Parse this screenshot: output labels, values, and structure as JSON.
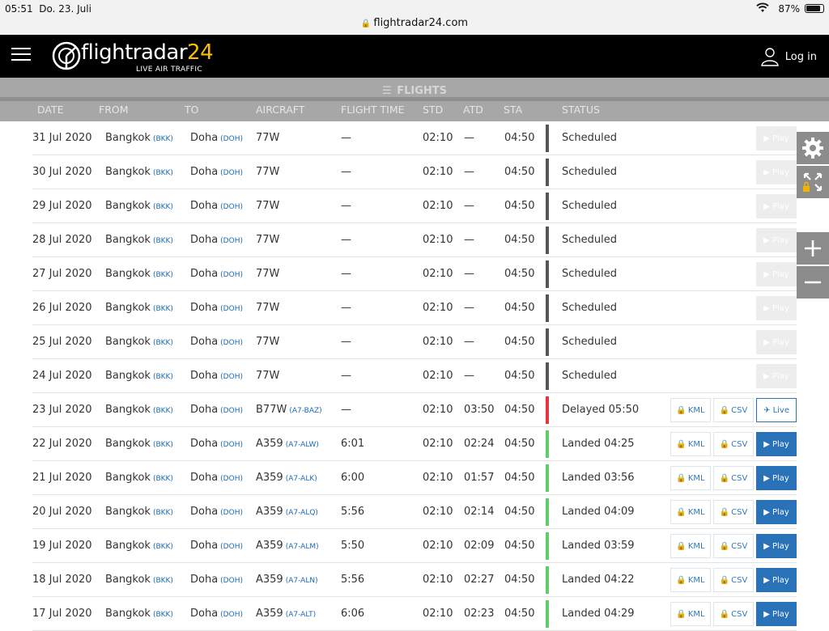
{
  "statusbar": {
    "time": "05:51",
    "date": "Do. 23. Juli",
    "battery": "87%",
    "battery_level": 0.87
  },
  "browser": {
    "url": "flightradar24.com"
  },
  "header": {
    "logo_word": "flightradar",
    "logo_num": "24",
    "logo_sub": "LIVE AIR TRAFFIC",
    "login_label": "Log in"
  },
  "flights_bar": {
    "title": "FLIGHTS",
    "columns": [
      "DATE",
      "FROM",
      "TO",
      "AIRCRAFT",
      "FLIGHT TIME",
      "STD",
      "ATD",
      "STA",
      "STATUS"
    ]
  },
  "colors": {
    "scheduled": "#555555",
    "delayed": "#e8343c",
    "landed": "#5fce6a",
    "accent": "#2a72b8",
    "logo_yellow": "#f5c000"
  },
  "rows": [
    {
      "date": "31 Jul 2020",
      "from": "Bangkok",
      "from_code": "(BKK)",
      "to": "Doha",
      "to_code": "(DOH)",
      "aircraft": "77W",
      "reg": "",
      "flight_time": "—",
      "std": "02:10",
      "atd": "—",
      "sta": "04:50",
      "status": "Scheduled",
      "status_kind": "scheduled",
      "play_label": "Play"
    },
    {
      "date": "30 Jul 2020",
      "from": "Bangkok",
      "from_code": "(BKK)",
      "to": "Doha",
      "to_code": "(DOH)",
      "aircraft": "77W",
      "reg": "",
      "flight_time": "—",
      "std": "02:10",
      "atd": "—",
      "sta": "04:50",
      "status": "Scheduled",
      "status_kind": "scheduled",
      "play_label": "Play"
    },
    {
      "date": "29 Jul 2020",
      "from": "Bangkok",
      "from_code": "(BKK)",
      "to": "Doha",
      "to_code": "(DOH)",
      "aircraft": "77W",
      "reg": "",
      "flight_time": "—",
      "std": "02:10",
      "atd": "—",
      "sta": "04:50",
      "status": "Scheduled",
      "status_kind": "scheduled",
      "play_label": "Play"
    },
    {
      "date": "28 Jul 2020",
      "from": "Bangkok",
      "from_code": "(BKK)",
      "to": "Doha",
      "to_code": "(DOH)",
      "aircraft": "77W",
      "reg": "",
      "flight_time": "—",
      "std": "02:10",
      "atd": "—",
      "sta": "04:50",
      "status": "Scheduled",
      "status_kind": "scheduled",
      "play_label": "Play"
    },
    {
      "date": "27 Jul 2020",
      "from": "Bangkok",
      "from_code": "(BKK)",
      "to": "Doha",
      "to_code": "(DOH)",
      "aircraft": "77W",
      "reg": "",
      "flight_time": "—",
      "std": "02:10",
      "atd": "—",
      "sta": "04:50",
      "status": "Scheduled",
      "status_kind": "scheduled",
      "play_label": "Play"
    },
    {
      "date": "26 Jul 2020",
      "from": "Bangkok",
      "from_code": "(BKK)",
      "to": "Doha",
      "to_code": "(DOH)",
      "aircraft": "77W",
      "reg": "",
      "flight_time": "—",
      "std": "02:10",
      "atd": "—",
      "sta": "04:50",
      "status": "Scheduled",
      "status_kind": "scheduled",
      "play_label": "Play"
    },
    {
      "date": "25 Jul 2020",
      "from": "Bangkok",
      "from_code": "(BKK)",
      "to": "Doha",
      "to_code": "(DOH)",
      "aircraft": "77W",
      "reg": "",
      "flight_time": "—",
      "std": "02:10",
      "atd": "—",
      "sta": "04:50",
      "status": "Scheduled",
      "status_kind": "scheduled",
      "play_label": "Play"
    },
    {
      "date": "24 Jul 2020",
      "from": "Bangkok",
      "from_code": "(BKK)",
      "to": "Doha",
      "to_code": "(DOH)",
      "aircraft": "77W",
      "reg": "",
      "flight_time": "—",
      "std": "02:10",
      "atd": "—",
      "sta": "04:50",
      "status": "Scheduled",
      "status_kind": "scheduled",
      "play_label": "Play"
    },
    {
      "date": "23 Jul 2020",
      "from": "Bangkok",
      "from_code": "(BKK)",
      "to": "Doha",
      "to_code": "(DOH)",
      "aircraft": "B77W",
      "reg": "(A7-BAZ)",
      "flight_time": "—",
      "std": "02:10",
      "atd": "03:50",
      "sta": "04:50",
      "status": "Delayed 05:50",
      "status_kind": "delayed",
      "kml": "KML",
      "csv": "CSV",
      "play_label": "Live"
    },
    {
      "date": "22 Jul 2020",
      "from": "Bangkok",
      "from_code": "(BKK)",
      "to": "Doha",
      "to_code": "(DOH)",
      "aircraft": "A359",
      "reg": "(A7-ALW)",
      "flight_time": "6:01",
      "std": "02:10",
      "atd": "02:24",
      "sta": "04:50",
      "status": "Landed 04:25",
      "status_kind": "landed",
      "kml": "KML",
      "csv": "CSV",
      "play_label": "Play"
    },
    {
      "date": "21 Jul 2020",
      "from": "Bangkok",
      "from_code": "(BKK)",
      "to": "Doha",
      "to_code": "(DOH)",
      "aircraft": "A359",
      "reg": "(A7-ALK)",
      "flight_time": "6:00",
      "std": "02:10",
      "atd": "01:57",
      "sta": "04:50",
      "status": "Landed 03:56",
      "status_kind": "landed",
      "kml": "KML",
      "csv": "CSV",
      "play_label": "Play"
    },
    {
      "date": "20 Jul 2020",
      "from": "Bangkok",
      "from_code": "(BKK)",
      "to": "Doha",
      "to_code": "(DOH)",
      "aircraft": "A359",
      "reg": "(A7-ALQ)",
      "flight_time": "5:56",
      "std": "02:10",
      "atd": "02:14",
      "sta": "04:50",
      "status": "Landed 04:09",
      "status_kind": "landed",
      "kml": "KML",
      "csv": "CSV",
      "play_label": "Play"
    },
    {
      "date": "19 Jul 2020",
      "from": "Bangkok",
      "from_code": "(BKK)",
      "to": "Doha",
      "to_code": "(DOH)",
      "aircraft": "A359",
      "reg": "(A7-ALM)",
      "flight_time": "5:50",
      "std": "02:10",
      "atd": "02:09",
      "sta": "04:50",
      "status": "Landed 03:59",
      "status_kind": "landed",
      "kml": "KML",
      "csv": "CSV",
      "play_label": "Play"
    },
    {
      "date": "18 Jul 2020",
      "from": "Bangkok",
      "from_code": "(BKK)",
      "to": "Doha",
      "to_code": "(DOH)",
      "aircraft": "A359",
      "reg": "(A7-ALN)",
      "flight_time": "5:56",
      "std": "02:10",
      "atd": "02:27",
      "sta": "04:50",
      "status": "Landed 04:22",
      "status_kind": "landed",
      "kml": "KML",
      "csv": "CSV",
      "play_label": "Play"
    },
    {
      "date": "17 Jul 2020",
      "from": "Bangkok",
      "from_code": "(BKK)",
      "to": "Doha",
      "to_code": "(DOH)",
      "aircraft": "A359",
      "reg": "(A7-ALT)",
      "flight_time": "6:06",
      "std": "02:10",
      "atd": "02:23",
      "sta": "04:50",
      "status": "Landed 04:29",
      "status_kind": "landed",
      "kml": "KML",
      "csv": "CSV",
      "play_label": "Play"
    }
  ],
  "side_tools": [
    {
      "icon": "gear-icon"
    },
    {
      "icon": "fullscreen-lock-icon"
    },
    {
      "icon": "zoom-in-icon",
      "glyph": "+"
    },
    {
      "icon": "zoom-out-icon",
      "glyph": "−"
    }
  ]
}
